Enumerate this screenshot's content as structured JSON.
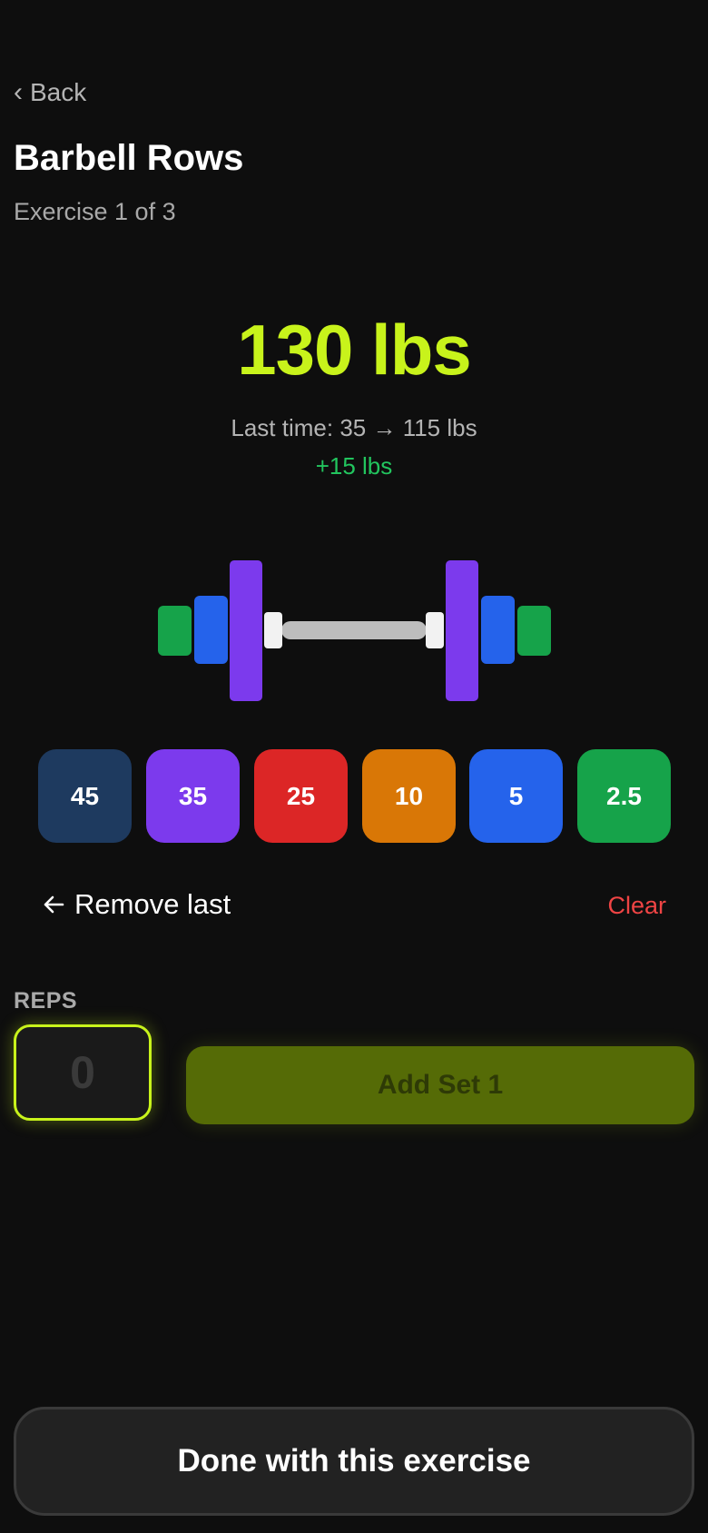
{
  "nav": {
    "back_label": "Back",
    "back_icon": "chevron-left-icon"
  },
  "exercise": {
    "title": "Barbell Rows",
    "progress": "Exercise 1 of 3"
  },
  "weight": {
    "current": "130 lbs",
    "last_time": "Last time: 35 → 115 lbs",
    "difference": "+15 lbs"
  },
  "plates": [
    {
      "label": "45",
      "color": "#1e3a5f"
    },
    {
      "label": "35",
      "color": "#7c3aed"
    },
    {
      "label": "25",
      "color": "#dc2626"
    },
    {
      "label": "10",
      "color": "#d97706"
    },
    {
      "label": "5",
      "color": "#2563eb"
    },
    {
      "label": "2.5",
      "color": "#16a34a"
    }
  ],
  "loaded_plates_per_side": [
    "35",
    "5",
    "2.5"
  ],
  "actions": {
    "remove_last": "Remove last",
    "remove_icon": "arrow-left-icon",
    "clear": "Clear"
  },
  "reps": {
    "label": "REPS",
    "value": "0",
    "add_set": "Add Set 1"
  },
  "footer": {
    "done": "Done with this exercise"
  },
  "colors": {
    "accent": "#c8f31b",
    "positive": "#22c55e",
    "danger": "#ef4444"
  }
}
